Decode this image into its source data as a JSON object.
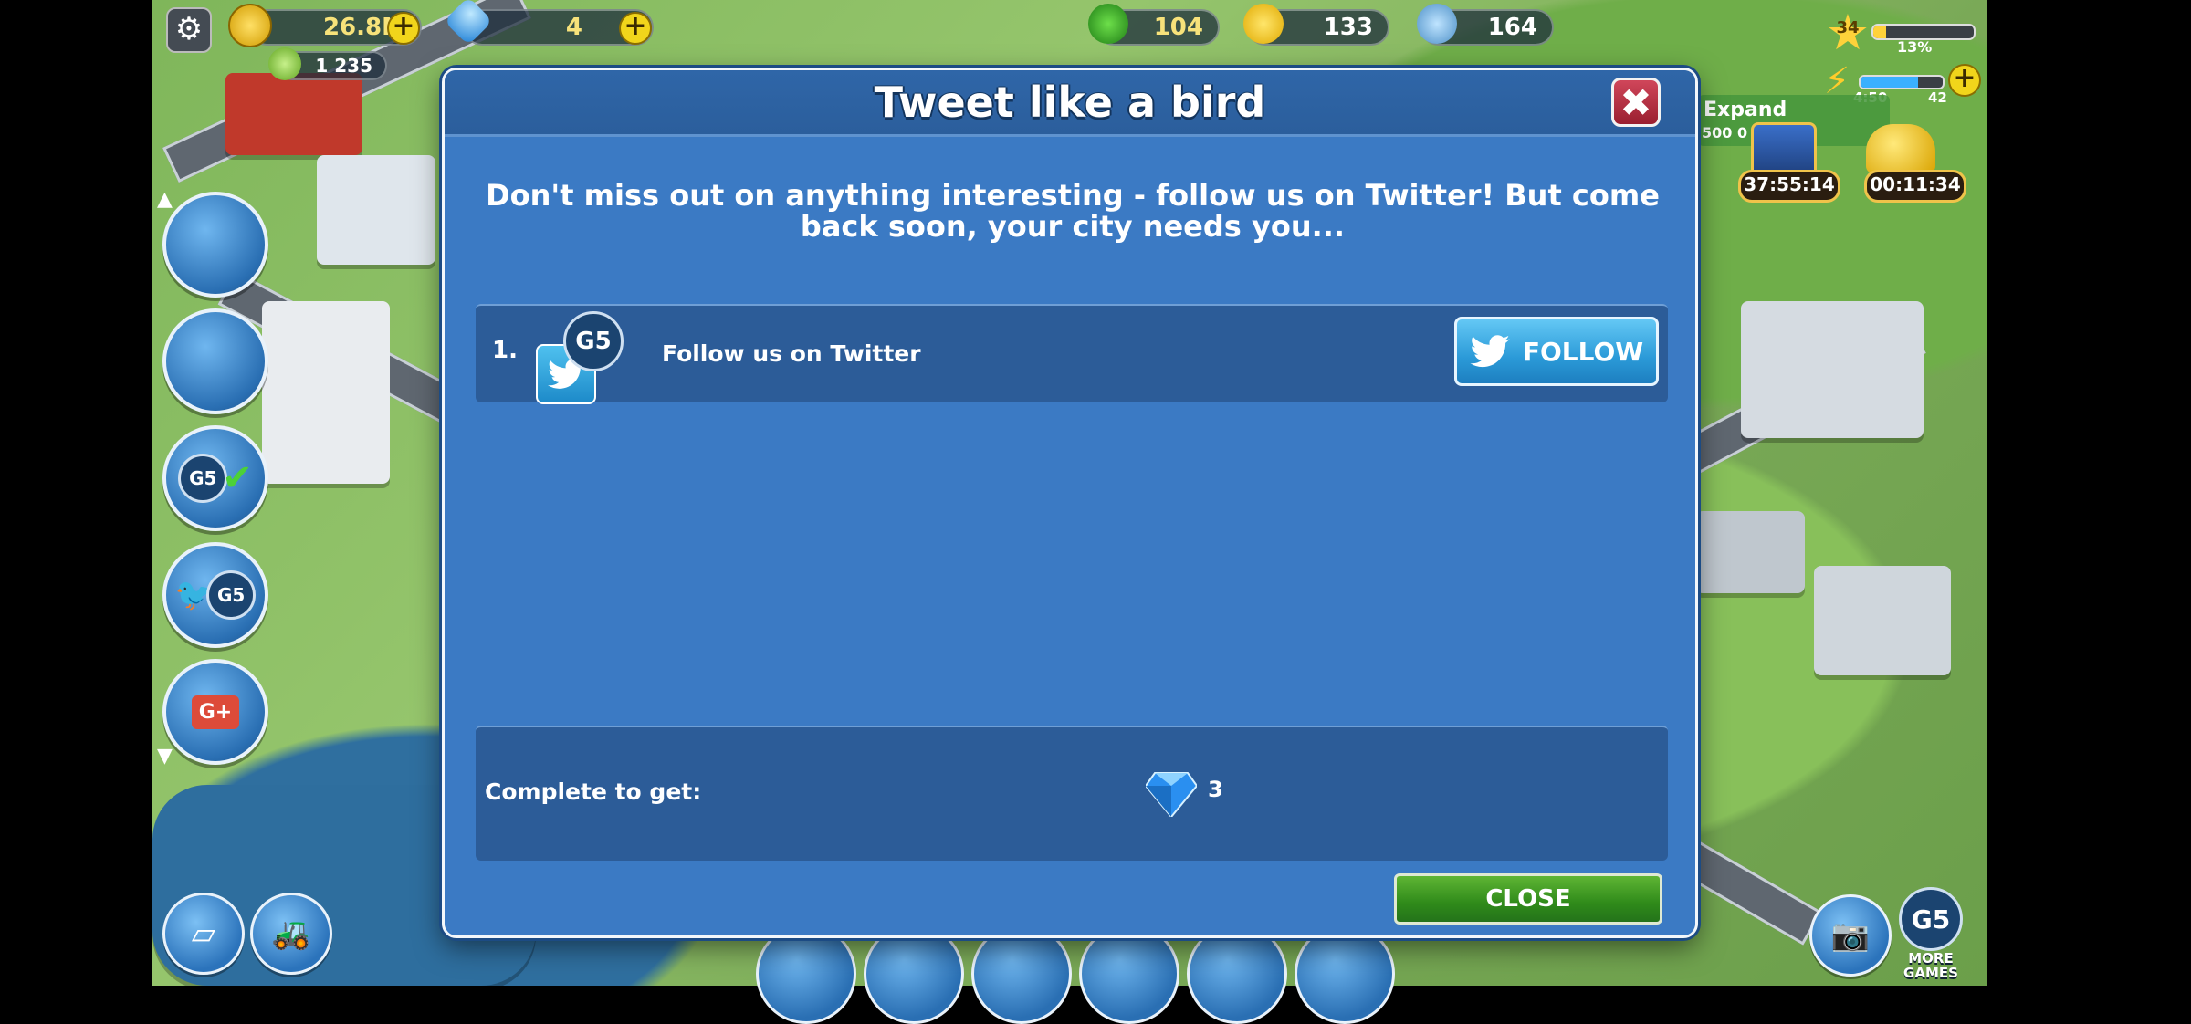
{
  "hud": {
    "coins": "26.8M",
    "gems": "4",
    "cash": "1 235",
    "trees": "104",
    "happiness": "133",
    "population": "164",
    "level": "34",
    "level_progress_label": "13%",
    "level_progress": 0.13,
    "energy_timer": "4:50",
    "energy_count": "42",
    "expand_label": "Expand",
    "expand_cost": "500 0",
    "chest_timer_1": "37:55:14",
    "chest_timer_2": "00:11:34",
    "more_games_label": "MORE GAMES",
    "g5_label": "G5",
    "g5_sub": "GAMES",
    "gplus": "G+"
  },
  "modal": {
    "title": "Tweet like a bird",
    "intro": "Don't miss out on anything interesting -  follow us on Twitter! But come back soon, your city needs you...",
    "tasks": [
      {
        "number": "1.",
        "label": "Follow us on Twitter",
        "button": "FOLLOW"
      }
    ],
    "reward_label": "Complete to get:",
    "reward_amount": "3",
    "close_button": "CLOSE"
  },
  "colors": {
    "modal_bg": "#3b7ac4",
    "panel_bg": "#2c5c98",
    "follow_btn": "#2b9ad8",
    "close_btn": "#2f8a1a",
    "close_x": "#b52f42"
  }
}
